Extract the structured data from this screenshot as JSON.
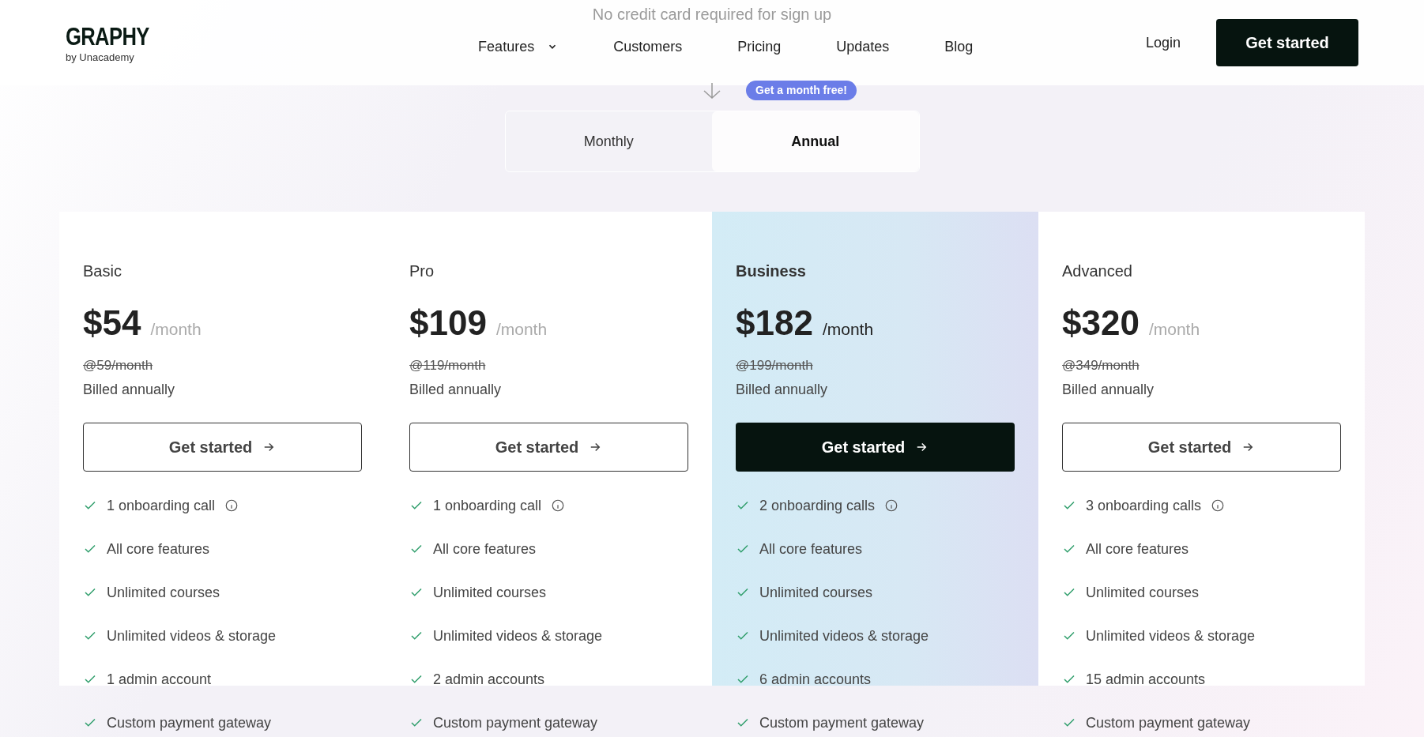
{
  "brand": {
    "logo": "GRAPHY",
    "tagline": "by Unacademy"
  },
  "nav": {
    "items": [
      {
        "label": "Features",
        "has_menu": true
      },
      {
        "label": "Customers",
        "has_menu": false
      },
      {
        "label": "Pricing",
        "has_menu": false
      },
      {
        "label": "Updates",
        "has_menu": false
      },
      {
        "label": "Blog",
        "has_menu": false
      }
    ],
    "login": "Login",
    "cta": "Get started"
  },
  "hero": {
    "note": "No credit card required for sign up",
    "badge": "Get a month free!"
  },
  "billing_toggle": [
    {
      "label": "Monthly",
      "selected": false
    },
    {
      "label": "Annual",
      "selected": true
    }
  ],
  "plans": [
    {
      "name": "Basic",
      "price": "$54",
      "period": "/month",
      "old_price": "@59/month",
      "billing": "Billed annually",
      "button": "Get started",
      "highlighted": false,
      "features": [
        {
          "text": "1 onboarding call",
          "info": true
        },
        {
          "text": "All core features",
          "info": false
        },
        {
          "text": "Unlimited courses",
          "info": false
        },
        {
          "text": "Unlimited videos & storage",
          "info": false
        },
        {
          "text": "1 admin account",
          "info": false
        },
        {
          "text": "Custom payment gateway",
          "info": false
        }
      ]
    },
    {
      "name": "Pro",
      "price": "$109",
      "period": "/month",
      "old_price": "@119/month",
      "billing": "Billed annually",
      "button": "Get started",
      "highlighted": false,
      "features": [
        {
          "text": "1 onboarding call",
          "info": true
        },
        {
          "text": "All core features",
          "info": false
        },
        {
          "text": "Unlimited courses",
          "info": false
        },
        {
          "text": "Unlimited videos & storage",
          "info": false
        },
        {
          "text": "2 admin accounts",
          "info": false
        },
        {
          "text": "Custom payment gateway",
          "info": false
        }
      ]
    },
    {
      "name": "Business",
      "price": "$182",
      "period": "/month",
      "old_price": "@199/month",
      "billing": "Billed annually",
      "button": "Get started",
      "highlighted": true,
      "features": [
        {
          "text": "2 onboarding calls",
          "info": true
        },
        {
          "text": "All core features",
          "info": false
        },
        {
          "text": "Unlimited courses",
          "info": false
        },
        {
          "text": "Unlimited videos & storage",
          "info": false
        },
        {
          "text": "6 admin accounts",
          "info": false
        },
        {
          "text": "Custom payment gateway",
          "info": false
        }
      ]
    },
    {
      "name": "Advanced",
      "price": "$320",
      "period": "/month",
      "old_price": "@349/month",
      "billing": "Billed annually",
      "button": "Get started",
      "highlighted": false,
      "features": [
        {
          "text": "3 onboarding calls",
          "info": true
        },
        {
          "text": "All core features",
          "info": false
        },
        {
          "text": "Unlimited courses",
          "info": false
        },
        {
          "text": "Unlimited videos & storage",
          "info": false
        },
        {
          "text": "15 admin accounts",
          "info": false
        },
        {
          "text": "Custom payment gateway",
          "info": false
        }
      ]
    }
  ]
}
